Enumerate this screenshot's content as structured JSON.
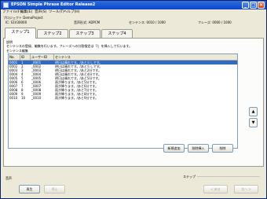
{
  "window": {
    "title": "EPSON Simple Phrase Editor Release2"
  },
  "menu": [
    "ファイル(F)",
    "編集(E)",
    "音声(S)",
    "ツール(T)",
    "ヘルプ(H)"
  ],
  "info": {
    "project_label": "プロジェクト DemoProject",
    "device": "IC: S1V30000",
    "format": "音声形式: ADPCM",
    "sentence_count": "センテンス: 0010 / 1000",
    "phrase_count": "フレーズ: 0000 / 1000"
  },
  "tabs": [
    "ステップ1",
    "ステップ2",
    "ステップ3",
    "ステップ4"
  ],
  "panel": {
    "heading": "説明",
    "description": "センテンスの登録、編集を行います。フレーズへの分割指定は「/」を挿入して行います。",
    "table_label": "センテンス編集"
  },
  "table": {
    "columns": [
      "No.",
      "ID",
      "ユーザーID",
      "センテンス"
    ],
    "rows": [
      {
        "no": "0001",
        "id": "1",
        "uid": "_0001",
        "text": "明日は晴れです。/あと少しです。"
      },
      {
        "no": "0002",
        "id": "2",
        "uid": "_0002",
        "text": "明日は晴れです。/あと少しです。"
      },
      {
        "no": "0003",
        "id": "3",
        "uid": "_0003",
        "text": "明日は晴れです。/あと2分です。"
      },
      {
        "no": "0004",
        "id": "4",
        "uid": "_0004",
        "text": "明日は晴れです。/あと4分です。"
      },
      {
        "no": "0005",
        "id": "5",
        "uid": "_0005",
        "text": "明日は晴れです。/あと5分です。"
      },
      {
        "no": "0006",
        "id": "6",
        "uid": "_0006",
        "text": "雨が降ります。/あと5分です。"
      },
      {
        "no": "0007",
        "id": "7",
        "uid": "_0007",
        "text": "雨が降ります。/あと6分です。"
      },
      {
        "no": "0008",
        "id": "8",
        "uid": "_0008",
        "text": "雨が降ります。/あと7分です。"
      },
      {
        "no": "0009",
        "id": "9",
        "uid": "_0009",
        "text": "雨が降ります。/あと8分です。"
      },
      {
        "no": "0010",
        "id": "10",
        "uid": "_0010",
        "text": "雨が降ります。/あと9分です。"
      }
    ]
  },
  "buttons": {
    "add": "新規追加",
    "edit": "削除挿入",
    "delete": "削除",
    "play": "再生",
    "stop": "停止",
    "prev": "< 戻る",
    "next": "次へ >"
  },
  "bottom": {
    "voice_label": "音声",
    "step_label": "ステップ"
  },
  "icons": {
    "up": "▲",
    "down": "▼"
  }
}
